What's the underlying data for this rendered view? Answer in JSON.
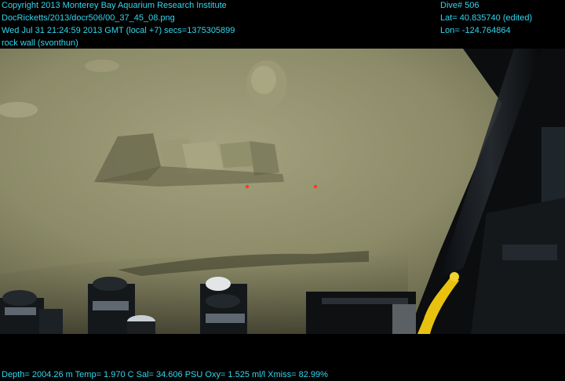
{
  "overlay": {
    "top_left": [
      "Copyright 2013 Monterey Bay Aquarium Research Institute",
      "DocRicketts/2013/docr506/00_37_45_08.png",
      "Wed Jul 31 21:24:59 2013 GMT (local +7)  secs=1375305899",
      "rock wall (svonthun)"
    ],
    "top_right": [
      "Dive# 506",
      "Lat= 40.835740 (edited)",
      "Lon= -124.764864"
    ],
    "bottom": "Depth= 2004.26 m  Temp= 1.970 C  Sal= 34.606 PSU  Oxy= 1.525 ml/l  Xmiss= 82.99%"
  },
  "colors": {
    "overlay_text": "#33d6ee",
    "letterbox": "#000000",
    "sediment": "#8c8b68",
    "sediment_shadow": "#5d5c41",
    "laser_dot": "#ff3a1e",
    "yellow_cable": "#e8c20e"
  }
}
